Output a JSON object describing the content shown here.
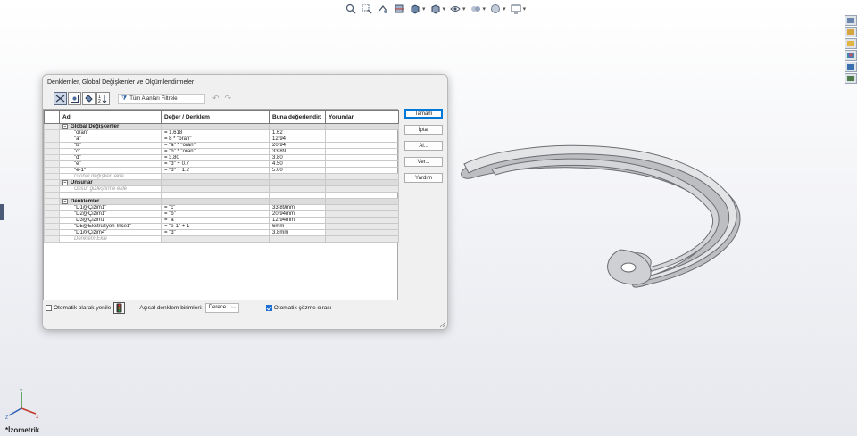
{
  "viewport": {
    "view_label": "*İzometrik",
    "hud_icons": [
      "zoom-to-fit-icon",
      "zoom-to-area-icon",
      "previous-view-icon",
      "section-view-icon",
      "view-orientation-icon",
      "display-style-icon",
      "hide-show-icon",
      "edit-appearance-icon",
      "apply-scene-icon",
      "view-settings-icon"
    ],
    "taskpane_icons": [
      "resources-icon",
      "design-library-icon",
      "file-explorer-icon",
      "appearances-icon",
      "custom-properties-icon",
      "solidworks-forum-icon"
    ]
  },
  "dialog": {
    "title": "Denklemler, Global Değişkenler ve Ölçümlendirmeler",
    "filter_label": "Tüm Alanları Filtrele",
    "columns": [
      "Ad",
      "Değer / Denklem",
      "Buna değerlendir:",
      "Yorumlar"
    ],
    "sections": {
      "globals": {
        "title": "Global Değişkenler",
        "rows": [
          {
            "name": "\"oran\"",
            "value": "= 1.618",
            "eval": "1.62"
          },
          {
            "name": "\"a\"",
            "value": "= 8 * \"oran\"",
            "eval": "12.94"
          },
          {
            "name": "\"b\"",
            "value": "= \"a\" * \"oran\"",
            "eval": "20.94"
          },
          {
            "name": "\"c\"",
            "value": "= \"b\" * \"oran\"",
            "eval": "33.89"
          },
          {
            "name": "\"d\"",
            "value": "= 3.80",
            "eval": "3.80"
          },
          {
            "name": "\"e\"",
            "value": "= \"d\" + 0.7",
            "eval": "4.50"
          },
          {
            "name": "\"e-1\"",
            "value": "= \"d\" + 1.2",
            "eval": "5.00"
          }
        ],
        "add_label": "Global değişken ekle"
      },
      "features": {
        "title": "Unsurlar",
        "add_label": "Unsur gizleştirme ekle"
      },
      "equations": {
        "title": "Denklemler",
        "rows": [
          {
            "name": "\"D1@Çizim1\"",
            "value": "= \"c\"",
            "eval": "33.89mm"
          },
          {
            "name": "\"D2@Çizim1\"",
            "value": "= \"b\"",
            "eval": "20.94mm"
          },
          {
            "name": "\"D3@Çizim1\"",
            "value": "= \"a\"",
            "eval": "12.94mm"
          },
          {
            "name": "\"D5@Ekstrüzyon-İnce1\"",
            "value": "= \"e-1\" + 1",
            "eval": "6mm"
          },
          {
            "name": "\"D1@Çizim4\"",
            "value": "= \"d\"",
            "eval": "3.8mm"
          }
        ],
        "add_label": "Denklem Ekle"
      }
    },
    "buttons": {
      "ok": "Tamam",
      "cancel": "İptal",
      "import": "Al...",
      "export": "Ver...",
      "help": "Yardım"
    },
    "auto_rebuild_label": "Otomatik olarak yenile",
    "auto_rebuild_checked": false,
    "angle_units_label": "Açısal denklem birimleri:",
    "angle_units_value": "Derece",
    "auto_solve_label": "Otomatik çözme sırası",
    "auto_solve_checked": true
  },
  "colors": {
    "accent": "#0078d7",
    "section_bg": "#dcdcdc",
    "model_face": "#c9cacd",
    "model_edge": "#6b6d72"
  }
}
